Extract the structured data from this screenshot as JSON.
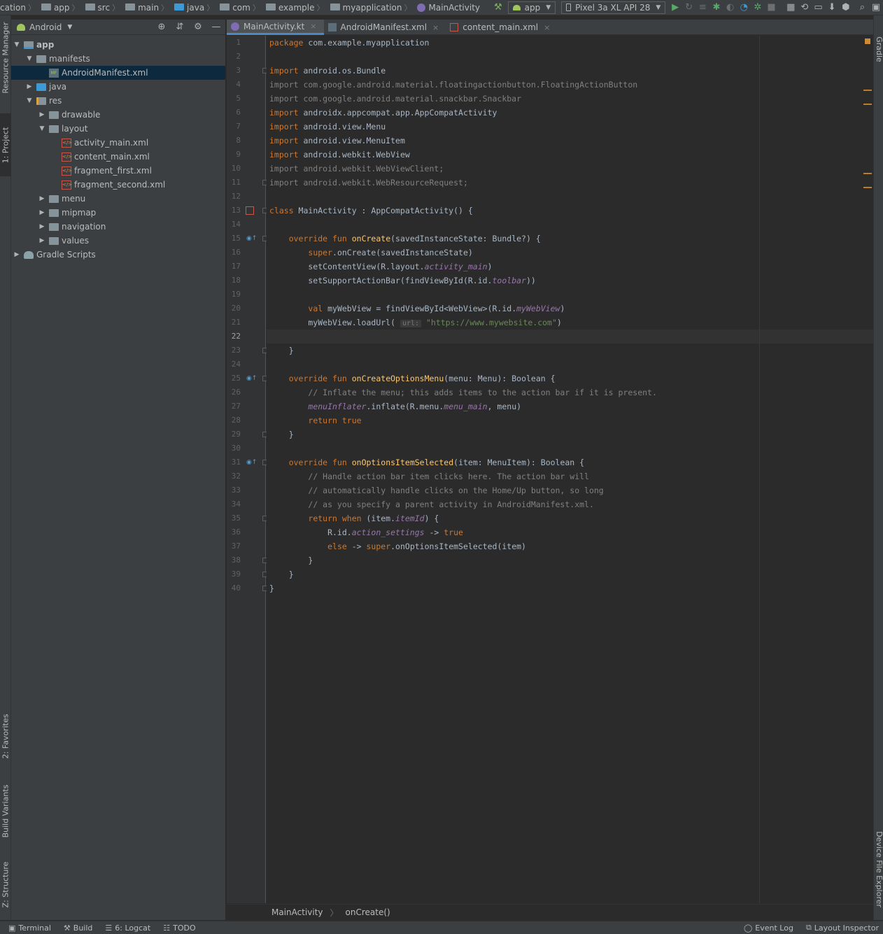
{
  "navbar": {
    "crumbs": [
      "cation",
      "app",
      "src",
      "main",
      "java",
      "com",
      "example",
      "myapplication",
      "MainActivity"
    ],
    "run_config": "app",
    "device": "Pixel 3a XL API 28"
  },
  "left_stripe": {
    "resource_manager": "Resource Manager",
    "project": "1: Project",
    "favorites": "2: Favorites",
    "build_variants": "Build Variants",
    "structure": "Z: Structure"
  },
  "right_stripe": {
    "gradle": "Gradle",
    "device_file_explorer": "Device File Explorer"
  },
  "project_panel": {
    "view_mode": "Android",
    "tree": [
      {
        "label": "app",
        "depth": 0,
        "expanded": true,
        "type": "module"
      },
      {
        "label": "manifests",
        "depth": 1,
        "expanded": true,
        "type": "folder"
      },
      {
        "label": "AndroidManifest.xml",
        "depth": 2,
        "type": "manifest",
        "selected": true
      },
      {
        "label": "java",
        "depth": 1,
        "expanded": false,
        "type": "folder-blue"
      },
      {
        "label": "res",
        "depth": 1,
        "expanded": true,
        "type": "folder-res"
      },
      {
        "label": "drawable",
        "depth": 2,
        "expanded": false,
        "type": "folder"
      },
      {
        "label": "layout",
        "depth": 2,
        "expanded": true,
        "type": "folder"
      },
      {
        "label": "activity_main.xml",
        "depth": 3,
        "type": "xml"
      },
      {
        "label": "content_main.xml",
        "depth": 3,
        "type": "xml"
      },
      {
        "label": "fragment_first.xml",
        "depth": 3,
        "type": "xml"
      },
      {
        "label": "fragment_second.xml",
        "depth": 3,
        "type": "xml"
      },
      {
        "label": "menu",
        "depth": 2,
        "expanded": false,
        "type": "folder"
      },
      {
        "label": "mipmap",
        "depth": 2,
        "expanded": false,
        "type": "folder"
      },
      {
        "label": "navigation",
        "depth": 2,
        "expanded": false,
        "type": "folder"
      },
      {
        "label": "values",
        "depth": 2,
        "expanded": false,
        "type": "folder"
      },
      {
        "label": "Gradle Scripts",
        "depth": 0,
        "expanded": false,
        "type": "gradle"
      }
    ]
  },
  "editor": {
    "tabs": [
      {
        "label": "MainActivity.kt",
        "active": true,
        "icon": "kotlin-file-icon"
      },
      {
        "label": "AndroidManifest.xml",
        "active": false,
        "icon": "manifest-file-icon"
      },
      {
        "label": "content_main.xml",
        "active": false,
        "icon": "xml-file-icon"
      }
    ],
    "current_line": 22,
    "lines": [
      "<span class=\"kw\">package</span> com.example.myapplication",
      "",
      "<span class=\"kw\">import</span> android.os.Bundle",
      "<span class=\"imp-un\">import com.google.android.material.floatingactionbutton.FloatingActionButton</span>",
      "<span class=\"imp-un\">import com.google.android.material.snackbar.Snackbar</span>",
      "<span class=\"kw\">import</span> androidx.appcompat.app.AppCompatActivity",
      "<span class=\"kw\">import</span> android.view.Menu",
      "<span class=\"kw\">import</span> android.view.MenuItem",
      "<span class=\"kw\">import</span> android.webkit.WebView",
      "<span class=\"imp-un\">import android.webkit.WebViewClient;</span>",
      "<span class=\"imp-un\">import android.webkit.WebResourceRequest;</span>",
      "",
      "<span class=\"kw\">class</span> MainActivity : AppCompatActivity() {",
      "",
      "    <span class=\"kw\">override fun</span> <span class=\"fn\">onCreate</span>(savedInstanceState: Bundle?) {",
      "        <span class=\"kw\">super</span>.onCreate(savedInstanceState)",
      "        setContentView(R.layout.<span class=\"it\">activity_main</span>)",
      "        setSupportActionBar(findViewById(R.id.<span class=\"it\">toolbar</span>))",
      "",
      "        <span class=\"kw\">val</span> myWebView = findViewById&lt;WebView&gt;(R.id.<span class=\"it\">myWebView</span>)",
      "        myWebView.loadUrl( <span class=\"hint\">url:</span> <span class=\"str\">\"https://www.mywebsite.com\"</span>)",
      "",
      "    }",
      "",
      "    <span class=\"kw\">override fun</span> <span class=\"fn\">onCreateOptionsMenu</span>(menu: Menu): Boolean {",
      "        <span class=\"cm\">// Inflate the menu; this adds items to the action bar if it is present.</span>",
      "        <span class=\"it\">menuInflater</span>.inflate(R.menu.<span class=\"it\">menu_main</span>, menu)",
      "        <span class=\"kw\">return true</span>",
      "    }",
      "",
      "    <span class=\"kw\">override fun</span> <span class=\"fn\">onOptionsItemSelected</span>(item: MenuItem): Boolean {",
      "        <span class=\"cm\">// Handle action bar item clicks here. The action bar will</span>",
      "        <span class=\"cm\">// automatically handle clicks on the Home/Up button, so long</span>",
      "        <span class=\"cm\">// as you specify a parent activity in AndroidManifest.xml.</span>",
      "        <span class=\"kw\">return when</span> (item.<span class=\"it\">itemId</span>) {",
      "            R.id.<span class=\"it\">action_settings</span> -&gt; <span class=\"kw\">true</span>",
      "            <span class=\"kw\">else</span> -&gt; <span class=\"kw\">super</span>.onOptionsItemSelected(item)",
      "        }",
      "    }",
      "}"
    ],
    "code_breadcrumbs": [
      "MainActivity",
      "onCreate()"
    ]
  },
  "status_bar": {
    "left": [
      {
        "label": "Terminal",
        "icon": "terminal-icon"
      },
      {
        "label": "Build",
        "icon": "hammer-icon"
      },
      {
        "label": "6: Logcat",
        "icon": "logcat-icon"
      },
      {
        "label": "TODO",
        "icon": "list-icon"
      }
    ],
    "right": [
      {
        "label": "Event Log",
        "icon": "event-log-icon"
      },
      {
        "label": "Layout Inspector",
        "icon": "layout-inspector-icon"
      }
    ]
  },
  "colors": {
    "background": "#2b2b2b",
    "panel": "#3c3f41",
    "keyword": "#cc7832",
    "function": "#ffc66d",
    "string": "#6a8759",
    "comment": "#808080",
    "field": "#9876aa",
    "selection": "#0d293e"
  }
}
